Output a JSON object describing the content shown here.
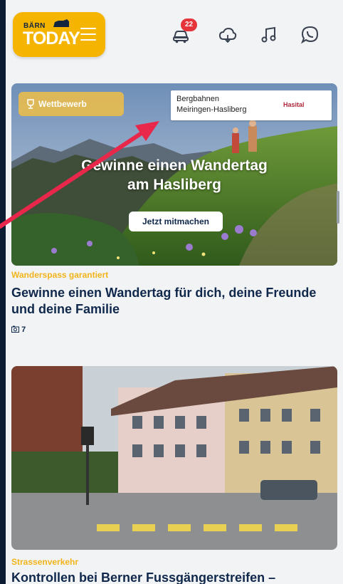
{
  "header": {
    "logo_small": "BÄRN",
    "logo_big": "TODAY",
    "notification_count": "22",
    "icons": [
      "car-icon",
      "weather-cloud-icon",
      "music-note-icon",
      "whatsapp-icon"
    ]
  },
  "articles": [
    {
      "contest_label": "Wettbewerb",
      "sponsor_line1": "Bergbahnen",
      "sponsor_line2": "Meiringen-Hasliberg",
      "sponsor_logo": "Hasital",
      "overlay_line1": "Gewinne einen Wandertag",
      "overlay_line2": "am Hasliberg",
      "cta_label": "Jetzt mitmachen",
      "kicker": "Wanderspass garantiert",
      "headline": "Gewinne einen Wandertag für dich, deine Freunde und deine Familie",
      "photo_count": "7"
    },
    {
      "kicker": "Strassenverkehr",
      "headline": "Kontrollen bei Berner Fussgängerstreifen –"
    }
  ],
  "colors": {
    "brand_yellow": "#f4b400",
    "headline_navy": "#10284b",
    "kicker_yellow": "#f1b51b",
    "badge_red": "#e5343a",
    "annotation_arrow": "#e8274b"
  }
}
